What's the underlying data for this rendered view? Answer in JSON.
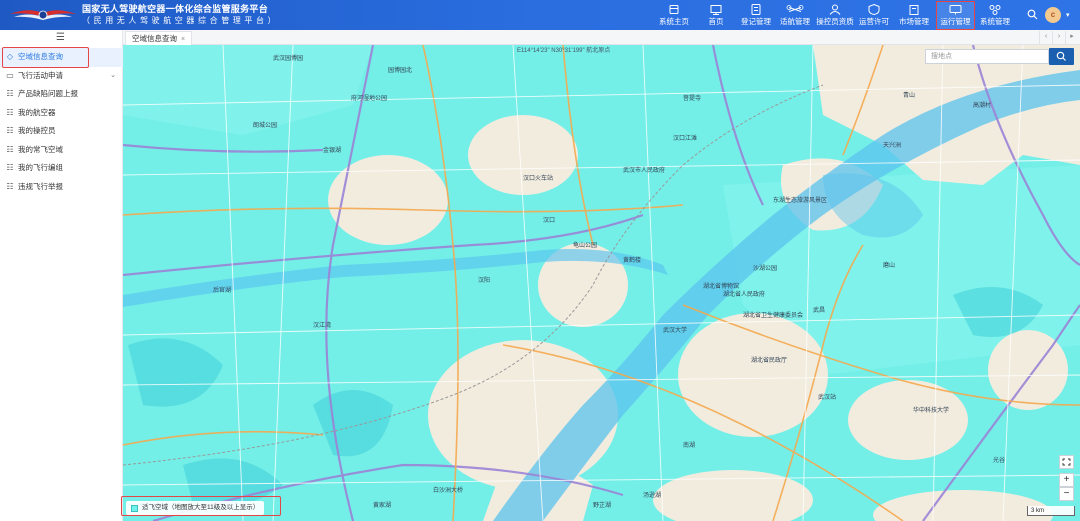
{
  "header": {
    "title_main": "国家无人驾驶航空器一体化综合监管服务平台",
    "title_sub": "（民用无人驾驶航空器综合管理平台）",
    "nav": [
      {
        "label": "系统主页",
        "icon": "home-page-icon"
      },
      {
        "label": "首页",
        "icon": "monitor-icon"
      },
      {
        "label": "登记管理",
        "icon": "register-icon"
      },
      {
        "label": "适航管理",
        "icon": "drone-icon"
      },
      {
        "label": "操控员资质",
        "icon": "operator-icon"
      },
      {
        "label": "运营许可",
        "icon": "shield-icon"
      },
      {
        "label": "市场管理",
        "icon": "market-icon"
      },
      {
        "label": "运行管理",
        "icon": "operation-icon",
        "active": true
      },
      {
        "label": "系统管理",
        "icon": "system-icon"
      }
    ],
    "avatar_letter": "c"
  },
  "sidebar": {
    "items": [
      {
        "label": "空域信息查询",
        "active": true
      },
      {
        "label": "飞行活动申请",
        "has_caret": true
      },
      {
        "label": "产品缺陷问题上报"
      },
      {
        "label": "我的航空器"
      },
      {
        "label": "我的操控员"
      },
      {
        "label": "我的常飞空域"
      },
      {
        "label": "我的飞行编组"
      },
      {
        "label": "违规飞行举报"
      }
    ]
  },
  "tabs": [
    {
      "label": "空域信息查询",
      "close": "×"
    }
  ],
  "map": {
    "coordinate_readout": "E114°14'23\"  N30°31'199\"  航北原点",
    "search_placeholder": "搜地点",
    "legend_label": "适飞空域（地图放大至11级及以上显示）",
    "scale_label": "3 km",
    "zoom_in": "+",
    "zoom_out": "−",
    "more": "···",
    "labels": [
      "园博园北",
      "府河湿地公园",
      "菩提寺",
      "朗城公园",
      "汉口江滩",
      "武汉市人民政府",
      "汉口火车站",
      "龟山公园",
      "黄鹤楼",
      "湖北省博物馆",
      "东湖生态旅游风景区",
      "湖北省人民政府",
      "湖北省卫生健康委员会",
      "湖北省民政厅",
      "武汉站",
      "沙湖公园",
      "武汉大学",
      "华中科技大学",
      "南湖",
      "汤逊湖",
      "后官湖",
      "金银湖",
      "汉江湾",
      "武汉园博园",
      "磨山",
      "野芷湖",
      "黄家湖",
      "青山",
      "高潮村",
      "天兴洲",
      "白沙洲大桥",
      "汉阳",
      "武昌",
      "汉口",
      "光谷"
    ]
  },
  "colors": {
    "header_blue": "#2a6ee0",
    "active_menu": "#2a7ae2",
    "highlight_red": "#e54545",
    "no_fly_cyan": "#6ff2ec",
    "river_blue": "#6ec9f0",
    "map_base": "#f1ede4"
  }
}
